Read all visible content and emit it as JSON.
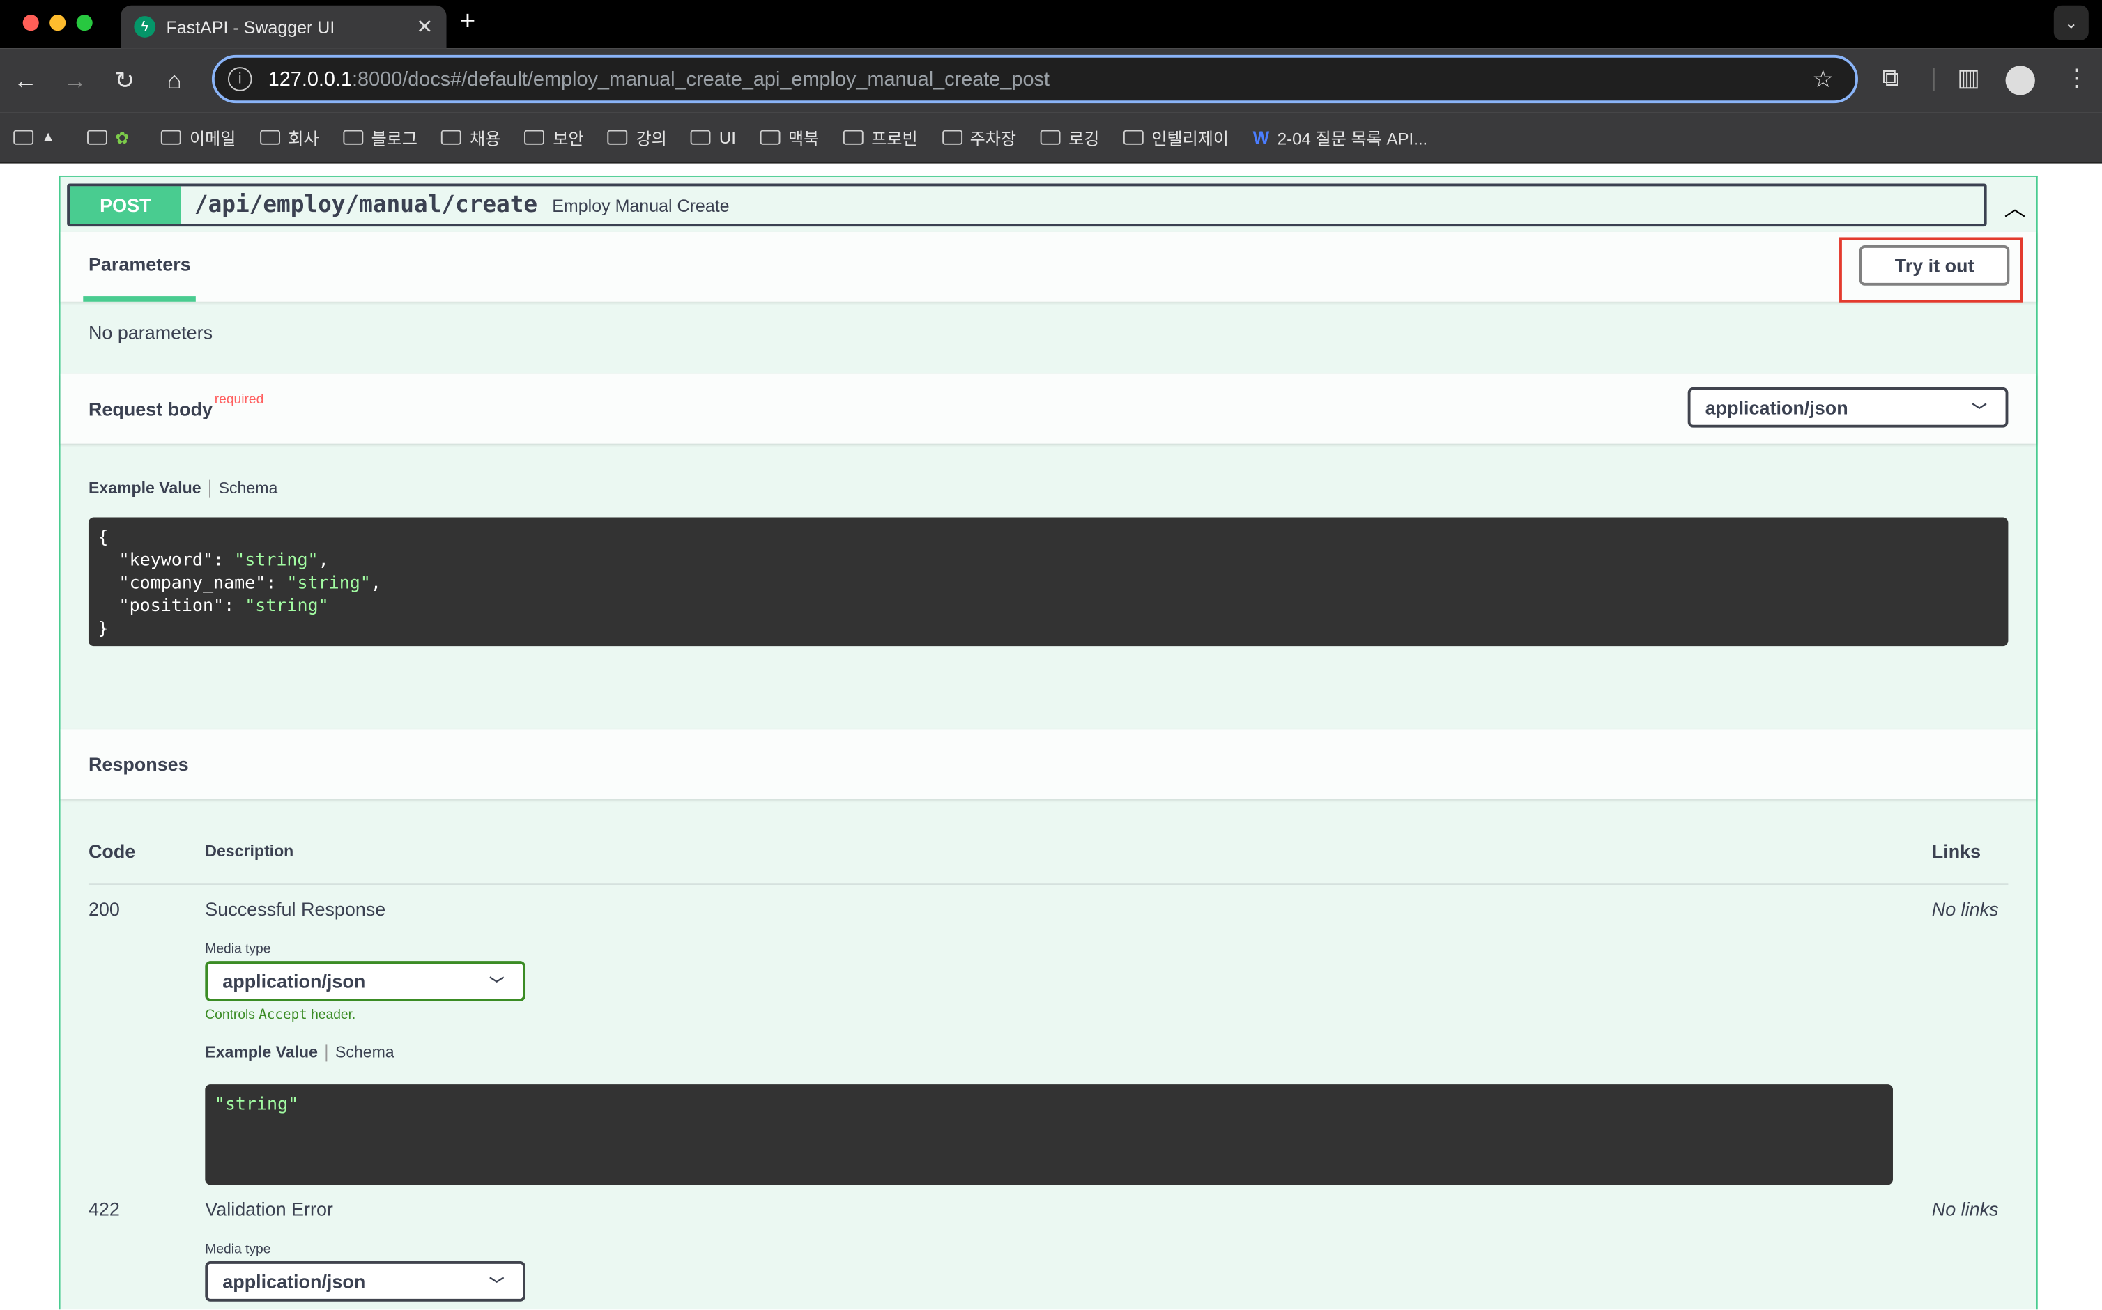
{
  "browser": {
    "tab_title": "FastAPI - Swagger UI",
    "tab_close": "✕",
    "new_tab": "+",
    "url_host": "127.0.0.1",
    "url_rest": ":8000/docs#/default/employ_manual_create_api_employ_manual_create_post",
    "bookmarks": [
      {
        "label": ""
      },
      {
        "label": ""
      },
      {
        "label": "이메일"
      },
      {
        "label": "회사"
      },
      {
        "label": "블로그"
      },
      {
        "label": "채용"
      },
      {
        "label": "보안"
      },
      {
        "label": "강의"
      },
      {
        "label": "UI"
      },
      {
        "label": "맥북"
      },
      {
        "label": "프로빈"
      },
      {
        "label": "주차장"
      },
      {
        "label": "로깅"
      },
      {
        "label": "인텔리제이"
      },
      {
        "label": "2-04 질문 목록 API..."
      }
    ]
  },
  "operation": {
    "method": "POST",
    "path": "/api/employ/manual/create",
    "summary": "Employ Manual Create"
  },
  "parameters": {
    "title": "Parameters",
    "try_it_out": "Try it out",
    "none_text": "No parameters"
  },
  "request_body": {
    "title": "Request body",
    "required": "required",
    "content_type": "application/json",
    "example_tab": "Example Value",
    "schema_tab": "Schema",
    "example_lines": {
      "open": "{",
      "k1": "\"keyword\"",
      "v1": "\"string\"",
      "k2": "\"company_name\"",
      "v2": "\"string\"",
      "k3": "\"position\"",
      "v3": "\"string\"",
      "close": "}"
    }
  },
  "responses": {
    "title": "Responses",
    "headers": {
      "code": "Code",
      "description": "Description",
      "links": "Links"
    },
    "rows": [
      {
        "code": "200",
        "description": "Successful Response",
        "links": "No links",
        "media_type_label": "Media type",
        "media_type": "application/json",
        "controls_pre": "Controls ",
        "controls_code": "Accept",
        "controls_post": " header.",
        "example_tab": "Example Value",
        "schema_tab": "Schema",
        "example": "\"string\""
      },
      {
        "code": "422",
        "description": "Validation Error",
        "links": "No links",
        "media_type_label": "Media type",
        "media_type": "application/json"
      }
    ]
  }
}
